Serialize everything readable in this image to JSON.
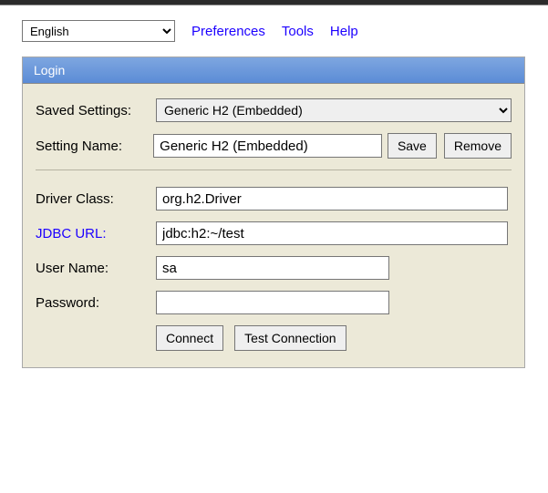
{
  "topnav": {
    "language_options": [
      "English"
    ],
    "language_selected": "English",
    "preferences": "Preferences",
    "tools": "Tools",
    "help": "Help"
  },
  "panel": {
    "title": "Login",
    "labels": {
      "saved_settings": "Saved Settings:",
      "setting_name": "Setting Name:",
      "driver_class": "Driver Class:",
      "jdbc_url": "JDBC URL:",
      "user_name": "User Name:",
      "password": "Password:"
    },
    "saved_settings_options": [
      "Generic H2 (Embedded)"
    ],
    "saved_settings_selected": "Generic H2 (Embedded)",
    "setting_name_value": "Generic H2 (Embedded)",
    "driver_class_value": "org.h2.Driver",
    "jdbc_url_value": "jdbc:h2:~/test",
    "user_name_value": "sa",
    "password_value": "",
    "buttons": {
      "save": "Save",
      "remove": "Remove",
      "connect": "Connect",
      "test_connection": "Test Connection"
    }
  }
}
